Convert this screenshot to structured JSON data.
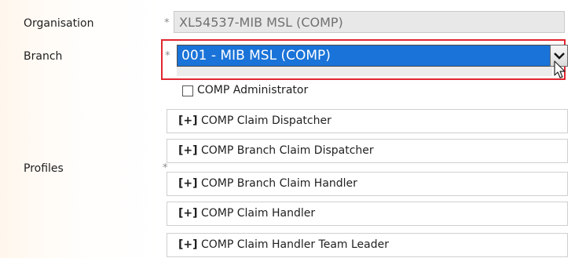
{
  "form": {
    "required_marker": "*",
    "organisation": {
      "label": "Organisation",
      "value": "XL54537-MIB MSL (COMP)"
    },
    "branch": {
      "label": "Branch",
      "value": "001 - MIB MSL (COMP)"
    },
    "profiles": {
      "label": "Profiles",
      "top_checkbox": {
        "label": "COMP Administrator",
        "checked": false
      },
      "groups": [
        {
          "expander": "[+]",
          "label": "COMP Claim Dispatcher"
        },
        {
          "expander": "[+]",
          "label": "COMP Branch Claim Dispatcher"
        },
        {
          "expander": "[+]",
          "label": "COMP Branch Claim Handler"
        },
        {
          "expander": "[+]",
          "label": "COMP Claim Handler"
        },
        {
          "expander": "[+]",
          "label": "COMP Claim Handler Team Leader"
        }
      ]
    }
  },
  "colors": {
    "selected_option_bg": "#1a73d8",
    "highlight_outline": "#e0262f",
    "disabled_field_bg": "#e8e8e8"
  },
  "icons": {
    "dropdown": "chevron-down-icon",
    "cursor": "mouse-pointer-icon"
  }
}
